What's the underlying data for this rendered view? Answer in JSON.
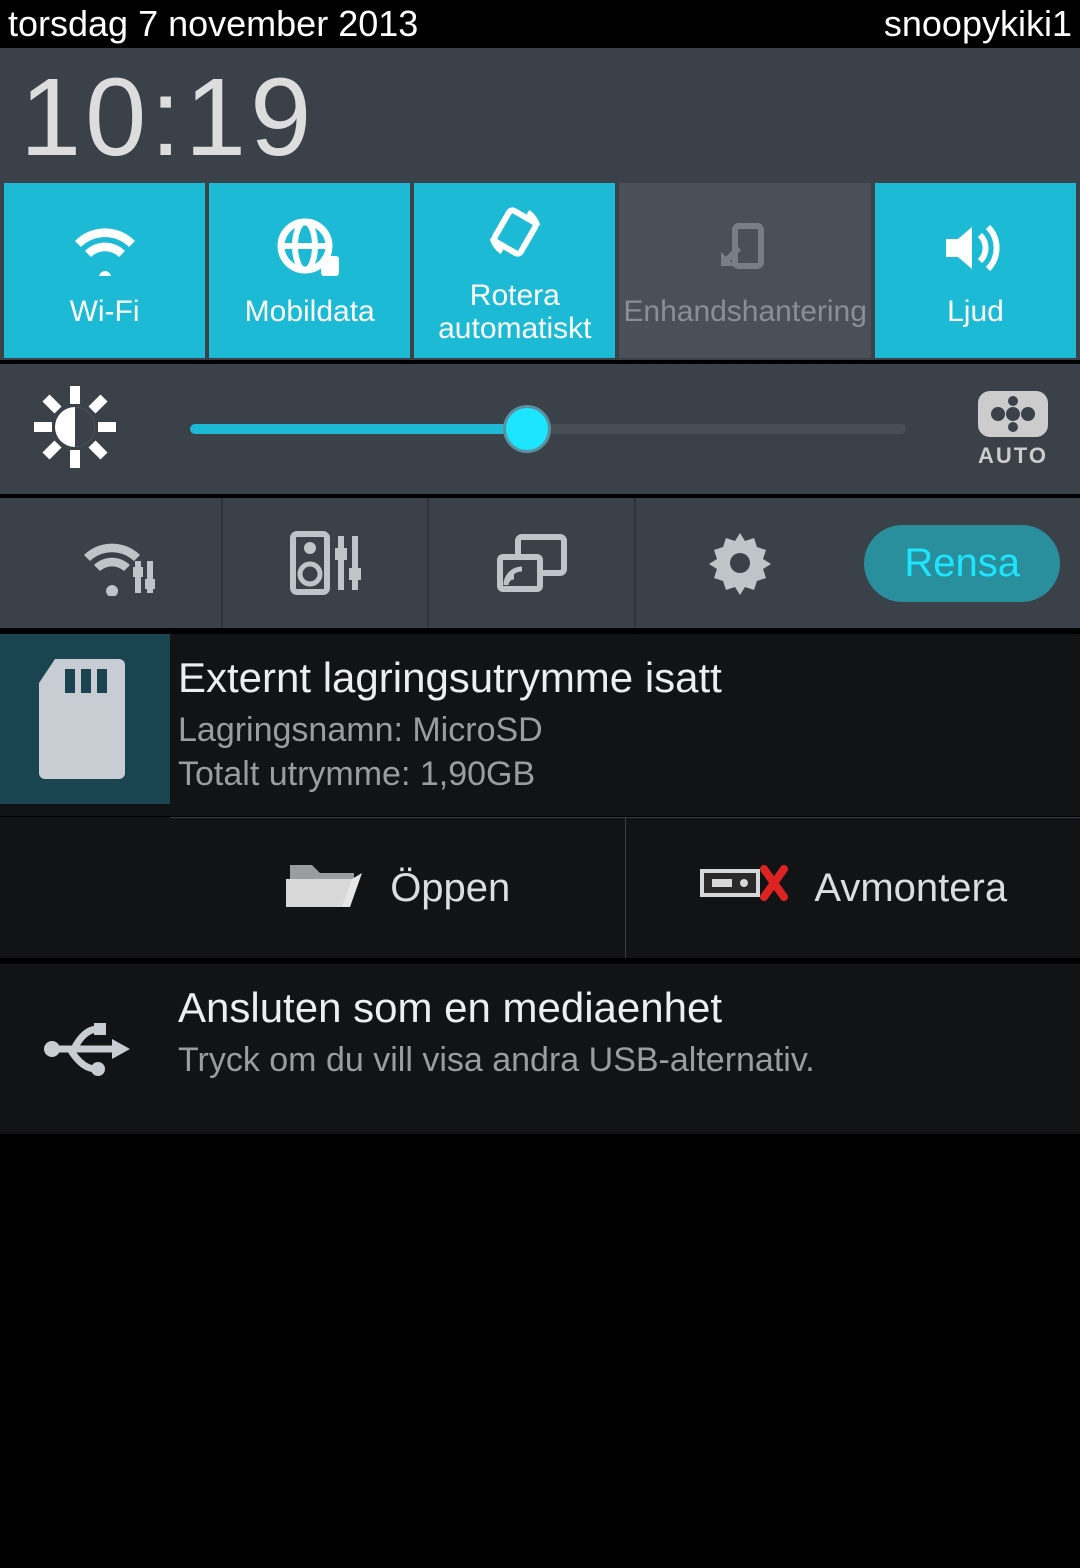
{
  "status_bar": {
    "date": "torsdag 7 november 2013",
    "user": "snoopykiki1"
  },
  "clock": "10:19",
  "toggles": [
    {
      "id": "wifi",
      "label": "Wi-Fi",
      "active": true
    },
    {
      "id": "mobildata",
      "label": "Mobildata",
      "active": true
    },
    {
      "id": "rotate",
      "label": "Rotera automatiskt",
      "active": true
    },
    {
      "id": "onehand",
      "label": "Enhandshantering",
      "active": false
    },
    {
      "id": "sound",
      "label": "Ljud",
      "active": true
    }
  ],
  "brightness": {
    "percent": 47,
    "auto_label": "AUTO"
  },
  "clear_label": "Rensa",
  "notifications": {
    "storage": {
      "title": "Externt lagringsutrymme isatt",
      "line1": "Lagringsnamn: MicroSD",
      "line2": "Totalt utrymme: 1,90GB",
      "open_label": "Öppen",
      "unmount_label": "Avmontera"
    },
    "usb": {
      "title": "Ansluten som en mediaenhet",
      "subtitle": "Tryck om du vill visa andra USB-alternativ."
    }
  }
}
